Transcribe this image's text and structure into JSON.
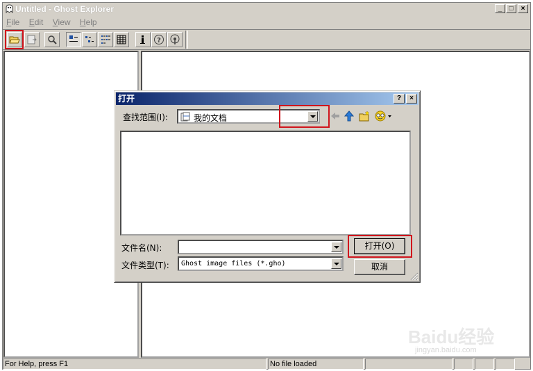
{
  "window": {
    "title": "Untitled - Ghost Explorer",
    "caption_buttons": {
      "minimize": "_",
      "maximize": "□",
      "close": "×"
    }
  },
  "menu": [
    {
      "label": "File",
      "accel": "F",
      "rest": "ile"
    },
    {
      "label": "Edit",
      "accel": "E",
      "rest": "dit"
    },
    {
      "label": "View",
      "accel": "V",
      "rest": "iew"
    },
    {
      "label": "Help",
      "accel": "H",
      "rest": "elp"
    }
  ],
  "toolbar": {
    "icons": [
      "open-folder-icon",
      "save-icon",
      "find-icon",
      "large-icons-icon",
      "small-icons-icon",
      "list-icon",
      "details-icon",
      "info-icon",
      "help-icon",
      "broadcast-icon"
    ]
  },
  "status": {
    "help_text": "For Help, press F1",
    "file_state": "No file loaded"
  },
  "dialog": {
    "title": "打开",
    "help_btn": "?",
    "close_btn": "×",
    "look_in_label": "查找范围(I):",
    "look_in_value": "我的文档",
    "filename_label": "文件名(N):",
    "filename_value": "",
    "filetype_label": "文件类型(T):",
    "filetype_value": "Ghost image files (*.gho)",
    "open_button": "打开(O)",
    "cancel_button": "取消"
  },
  "watermark": {
    "brand": "Baidu经验",
    "url": "jingyan.baidu.com"
  },
  "colors": {
    "face": "#d4d0c8",
    "highlight_red": "#d0141c",
    "dialog_title_start": "#0a246a",
    "dialog_title_end": "#a6caf0"
  }
}
